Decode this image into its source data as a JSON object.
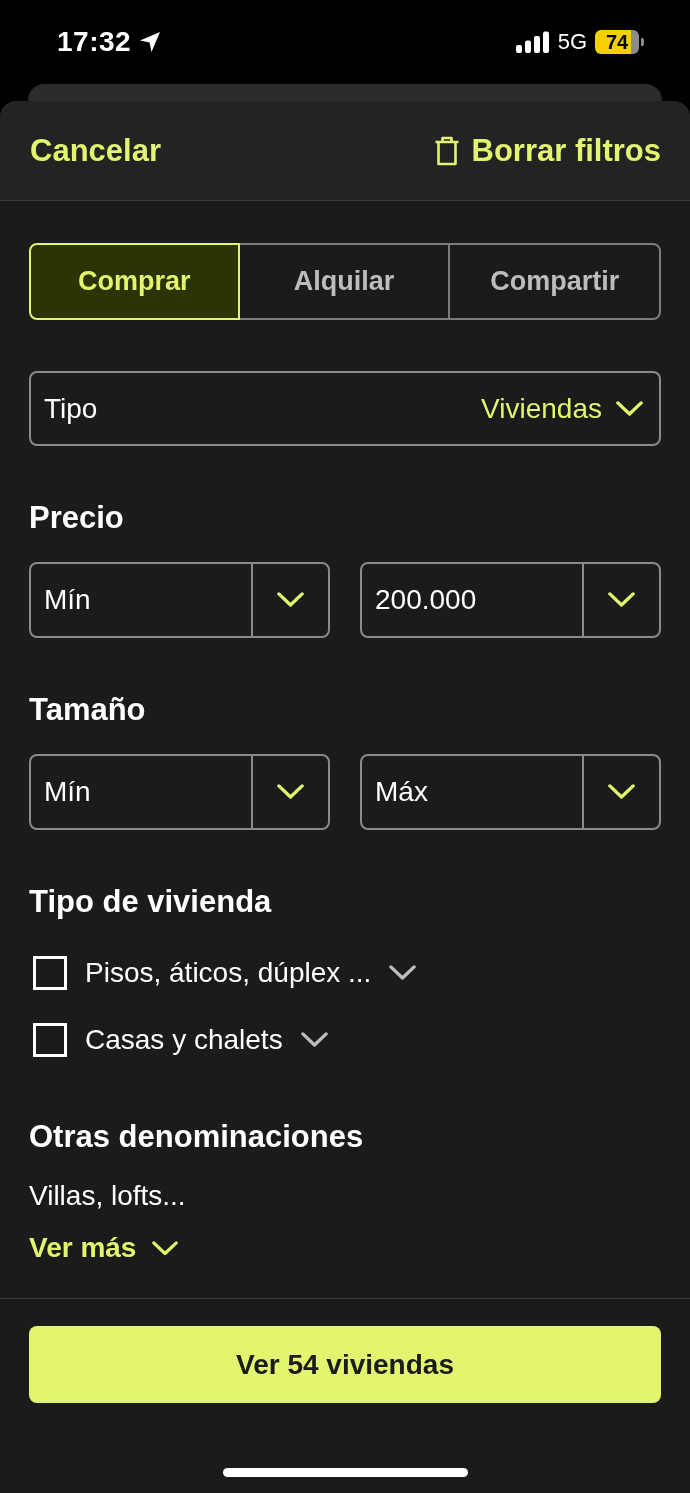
{
  "status_bar": {
    "time": "17:32",
    "network": "5G",
    "battery": "74"
  },
  "header": {
    "cancel": "Cancelar",
    "clear": "Borrar filtros"
  },
  "operation_tabs": [
    {
      "label": "Comprar",
      "selected": true
    },
    {
      "label": "Alquilar",
      "selected": false
    },
    {
      "label": "Compartir",
      "selected": false
    }
  ],
  "type_select": {
    "label": "Tipo",
    "value": "Viviendas"
  },
  "ranges": [
    {
      "title": "Precio",
      "fields": [
        {
          "value": "Mín"
        },
        {
          "value": "200.000"
        }
      ]
    },
    {
      "title": "Tamaño",
      "fields": [
        {
          "value": "Mín"
        },
        {
          "value": "Máx"
        }
      ]
    }
  ],
  "property_types": {
    "title": "Tipo de vivienda",
    "items": [
      {
        "label": "Pisos, áticos, dúplex ...",
        "checked": false
      },
      {
        "label": "Casas y chalets",
        "checked": false
      }
    ]
  },
  "other_names": {
    "title": "Otras denominaciones",
    "text": "Villas, lofts...",
    "more": "Ver más"
  },
  "footer": {
    "button": "Ver 54 viviendas"
  }
}
